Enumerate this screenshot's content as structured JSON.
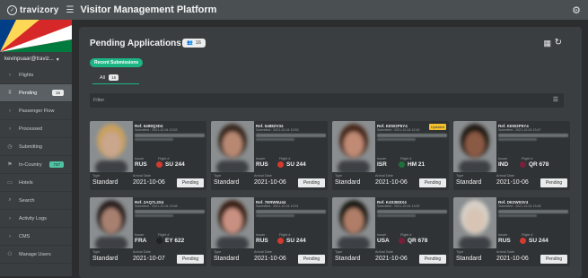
{
  "topbar": {
    "brand": "travizory",
    "app_title": "Visitor Management Platform"
  },
  "sidebar": {
    "user": "kevinpuaar@traviz...",
    "items": [
      {
        "label": "Flights",
        "icon": "chevron-right-icon"
      },
      {
        "label": "Pending",
        "icon": "pending-icon",
        "badge": "16",
        "active": true
      },
      {
        "label": "Passenger Flow",
        "icon": "chevron-right-icon"
      },
      {
        "label": "Processed",
        "icon": "chevron-right-icon"
      },
      {
        "label": "Submitting",
        "icon": "clock-icon"
      },
      {
        "label": "In-Country",
        "icon": "flag-icon",
        "badge": "747"
      },
      {
        "label": "Hotels",
        "icon": "bed-icon"
      },
      {
        "label": "Search",
        "icon": "search-icon"
      },
      {
        "label": "Activity Logs",
        "icon": "chevron-right-icon"
      },
      {
        "label": "CMS",
        "icon": "chevron-right-icon"
      },
      {
        "label": "Manage Users",
        "icon": "users-icon"
      }
    ]
  },
  "main": {
    "title": "Pending Applications",
    "count": "16",
    "recent": "Recent Submissions",
    "tab_all": "All",
    "tab_all_count": "16",
    "filter_placeholder": "Filter"
  },
  "labels": {
    "issuer": "Issuer",
    "flight": "Flight #",
    "type": "Type",
    "arrival": "Arrival Date",
    "pending": "Pending",
    "updated": "Updated"
  },
  "cards": [
    {
      "ref": "Ref. 5499Q3D4",
      "submitted": "Submitted : 2021-10-04 13:53",
      "issuer": "RUS",
      "flight": "SU 244",
      "type": "Standard",
      "arrival": "2021-10-06",
      "flag": "#d43a2f",
      "updated": false,
      "skin": "#c9a68c",
      "hair": "#c8a060"
    },
    {
      "ref": "Ref. 5488ZV34",
      "submitted": "Submitted : 2021-10-04 13:53",
      "issuer": "RUS",
      "flight": "SU 244",
      "type": "Standard",
      "arrival": "2021-10-06",
      "flag": "#d43a2f",
      "updated": false,
      "skin": "#b88872",
      "hair": "#3a2a22"
    },
    {
      "ref": "Ref. KEW2P5Y4",
      "submitted": "Submitted : 2021-10-04 12:42",
      "issuer": "ISR",
      "flight": "HM 21",
      "type": "Standard",
      "arrival": "2021-10-06",
      "flag": "#1f6f3a",
      "updated": true,
      "skin": "#c08a74",
      "hair": "#4a2a1e"
    },
    {
      "ref": "Ref. KEW2P5Y4",
      "submitted": "Submitted : 2021-10-04 13:47",
      "issuer": "IND",
      "flight": "QR 678",
      "type": "Standard",
      "arrival": "2021-10-06",
      "flag": "#7a1f3a",
      "updated": false,
      "skin": "#8a5a44",
      "hair": "#221a16"
    },
    {
      "ref": "Ref. 2AQ7L3S4",
      "submitted": "Submitted : 2021-10-04 13:58",
      "issuer": "FRA",
      "flight": "EY 622",
      "type": "Standard",
      "arrival": "2021-10-07",
      "flag": "#222222",
      "updated": false,
      "skin": "#a88070",
      "hair": "#2a2220"
    },
    {
      "ref": "Ref. 7ERW5U44",
      "submitted": "Submitted : 2021-10-04 13:51",
      "issuer": "RUS",
      "flight": "SU 244",
      "type": "Standard",
      "arrival": "2021-10-06",
      "flag": "#d43a2f",
      "updated": false,
      "skin": "#c89080",
      "hair": "#3a2018"
    },
    {
      "ref": "Ref. K4S3M3X4",
      "submitted": "Submitted : 2021-10-04 13:52",
      "issuer": "USA",
      "flight": "QR 678",
      "type": "Standard",
      "arrival": "2021-10-06",
      "flag": "#7a1f3a",
      "updated": false,
      "skin": "#b07e68",
      "hair": "#1e1a18"
    },
    {
      "ref": "Ref. DE2W03V4",
      "submitted": "Submitted : 2021-10-04 13:48",
      "issuer": "RUS",
      "flight": "SU 244",
      "type": "Standard",
      "arrival": "2021-10-06",
      "flag": "#d43a2f",
      "updated": false,
      "skin": "#d8c4b4",
      "hair": "#d6cfc6"
    }
  ]
}
